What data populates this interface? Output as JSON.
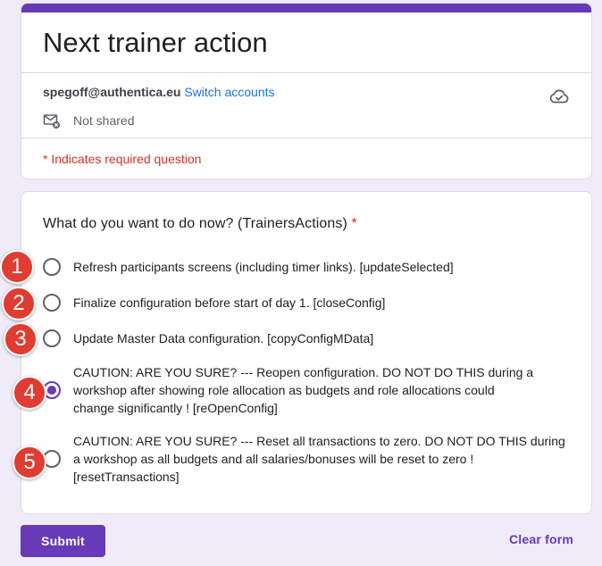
{
  "form": {
    "title": "Next trainer action",
    "account_email": "spegoff@authentica.eu",
    "switch_accounts": "Switch accounts",
    "not_shared": "Not shared",
    "required_note": "* Indicates required question",
    "accent_color": "#673ab7"
  },
  "question": {
    "title": "What do you want to do now?   (TrainersActions)",
    "required_marker": "*",
    "options": [
      {
        "label": "Refresh participants screens (including timer links).   [updateSelected]",
        "checked": false,
        "badge": "1"
      },
      {
        "label": "Finalize configuration before start of day 1.   [closeConfig]",
        "checked": false,
        "badge": "2"
      },
      {
        "label": "Update Master Data configuration.   [copyConfigMData]",
        "checked": false,
        "badge": "3"
      },
      {
        "label": "CAUTION: ARE YOU SURE? --- Reopen configuration. DO NOT DO THIS during a workshop after showing role allocation as budgets and role allocations could change significantly !  [reOpenConfig]",
        "checked": true,
        "badge": "4"
      },
      {
        "label": "CAUTION: ARE YOU SURE? --- Reset all transactions to zero.  DO NOT DO THIS during a workshop as all budgets and all salaries/bonuses will be reset to zero !  [resetTransactions]",
        "checked": false,
        "badge": "5"
      }
    ]
  },
  "actions": {
    "submit": "Submit",
    "clear": "Clear form"
  },
  "icons": {
    "cloud": "cloud-check-icon",
    "mail": "mail-not-shared-icon"
  },
  "badge_color": "#e03c31"
}
